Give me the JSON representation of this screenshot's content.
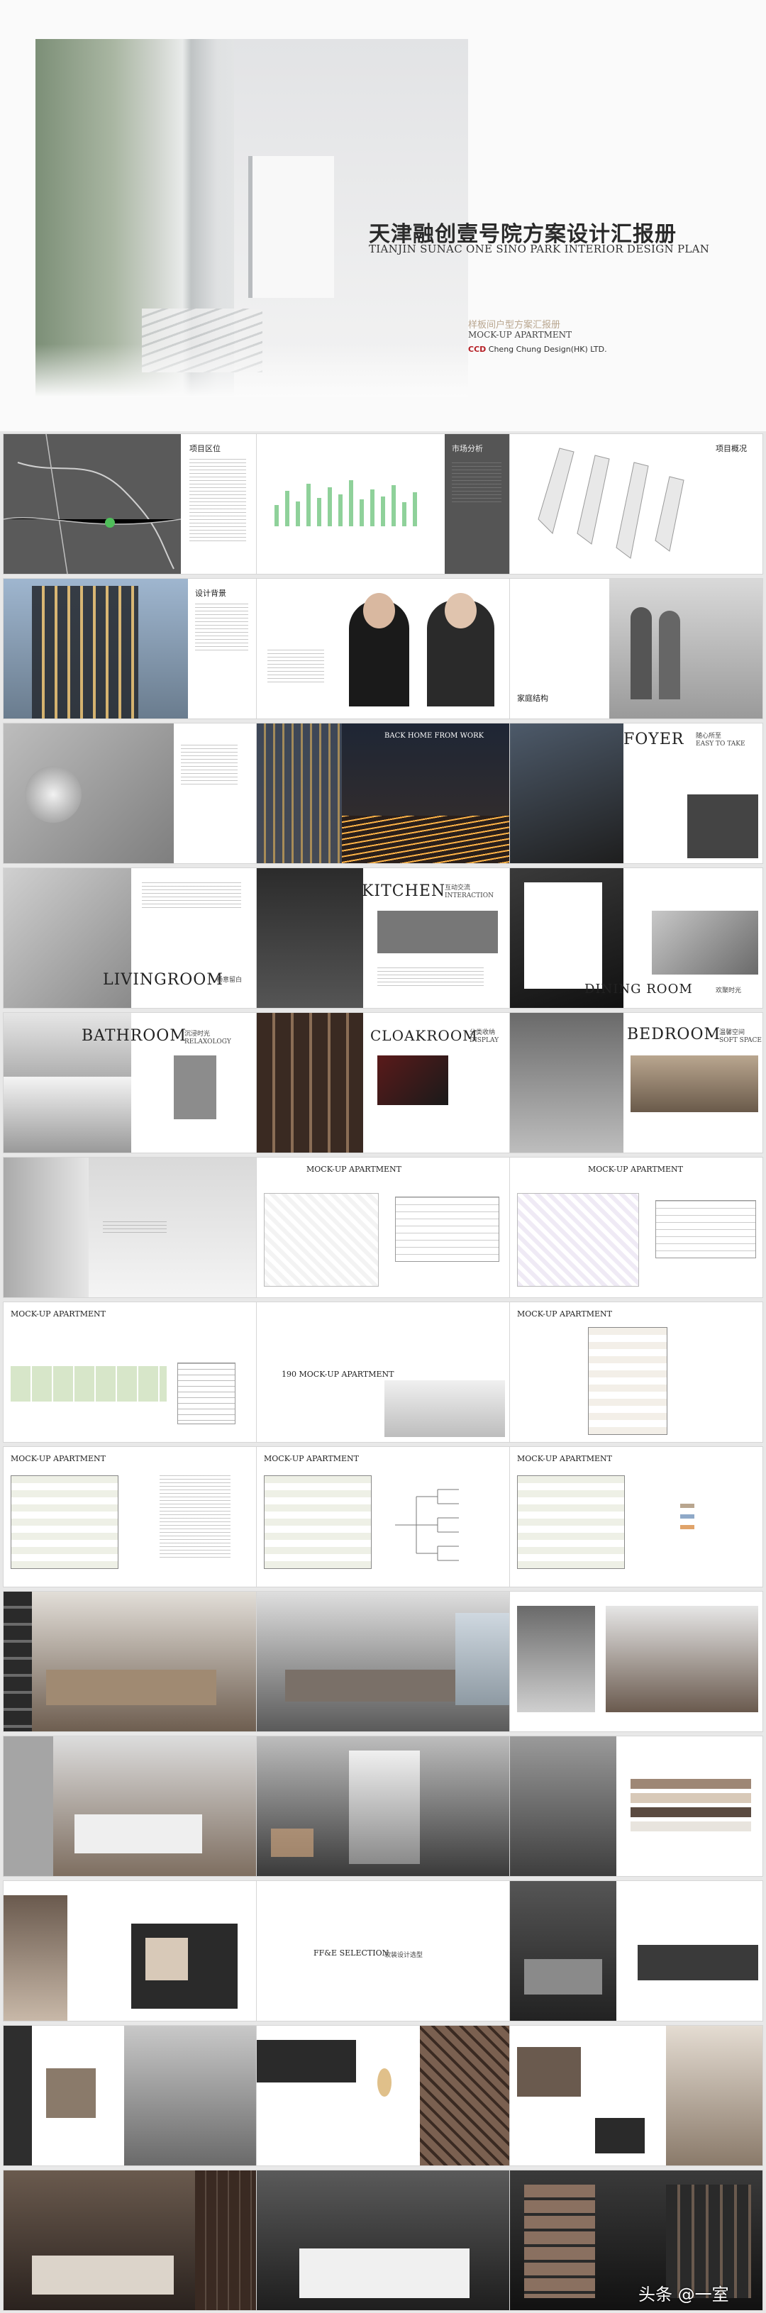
{
  "cover": {
    "title": "天津融创壹号院方案设计汇报册",
    "subtitle": "TIANJIN SUNAC ONE SINO PARK INTERIOR DESIGN PLAN",
    "mockup_cn": "样板间户型方案汇报册",
    "mockup_en": "MOCK-UP APARTMENT",
    "company_logo": "CCD",
    "company_name": "Cheng Chung Design(HK) LTD."
  },
  "slides": {
    "project_location": "项目区位",
    "market_analysis": "市场分析",
    "project_overview": "项目概况",
    "design_concept": "设计背景",
    "family": "家庭结构",
    "back_home": "BACK HOME FROM WORK",
    "foyer": "FOYER",
    "foyer_cn": "随心所至",
    "foyer_en": "EASY TO TAKE",
    "livingroom": "LIVINGROOM",
    "livingroom_cn": "畅意留白",
    "kitchen": "KITCHEN",
    "kitchen_cn": "互动交流",
    "kitchen_en": "INTERACTION",
    "dining": "DINING ROOM",
    "dining_cn": "欢聚时光",
    "bathroom": "BATHROOM",
    "bathroom_cn": "沉浸时光",
    "bathroom_en": "RELAXOLOGY",
    "cloakroom": "CLOAKROOM",
    "cloakroom_cn": "分类收纳",
    "cloakroom_en": "DISPLAY",
    "bedroom": "BEDROOM",
    "bedroom_cn": "温馨空间",
    "bedroom_en": "SOFT SPACE",
    "mockup": "MOCK-UP APARTMENT",
    "mockup_190": "190 MOCK-UP APARTMENT",
    "ffe": "FF&E SELECTION",
    "ffe_cn": "软装设计选型"
  },
  "watermark": "头条 @一室"
}
